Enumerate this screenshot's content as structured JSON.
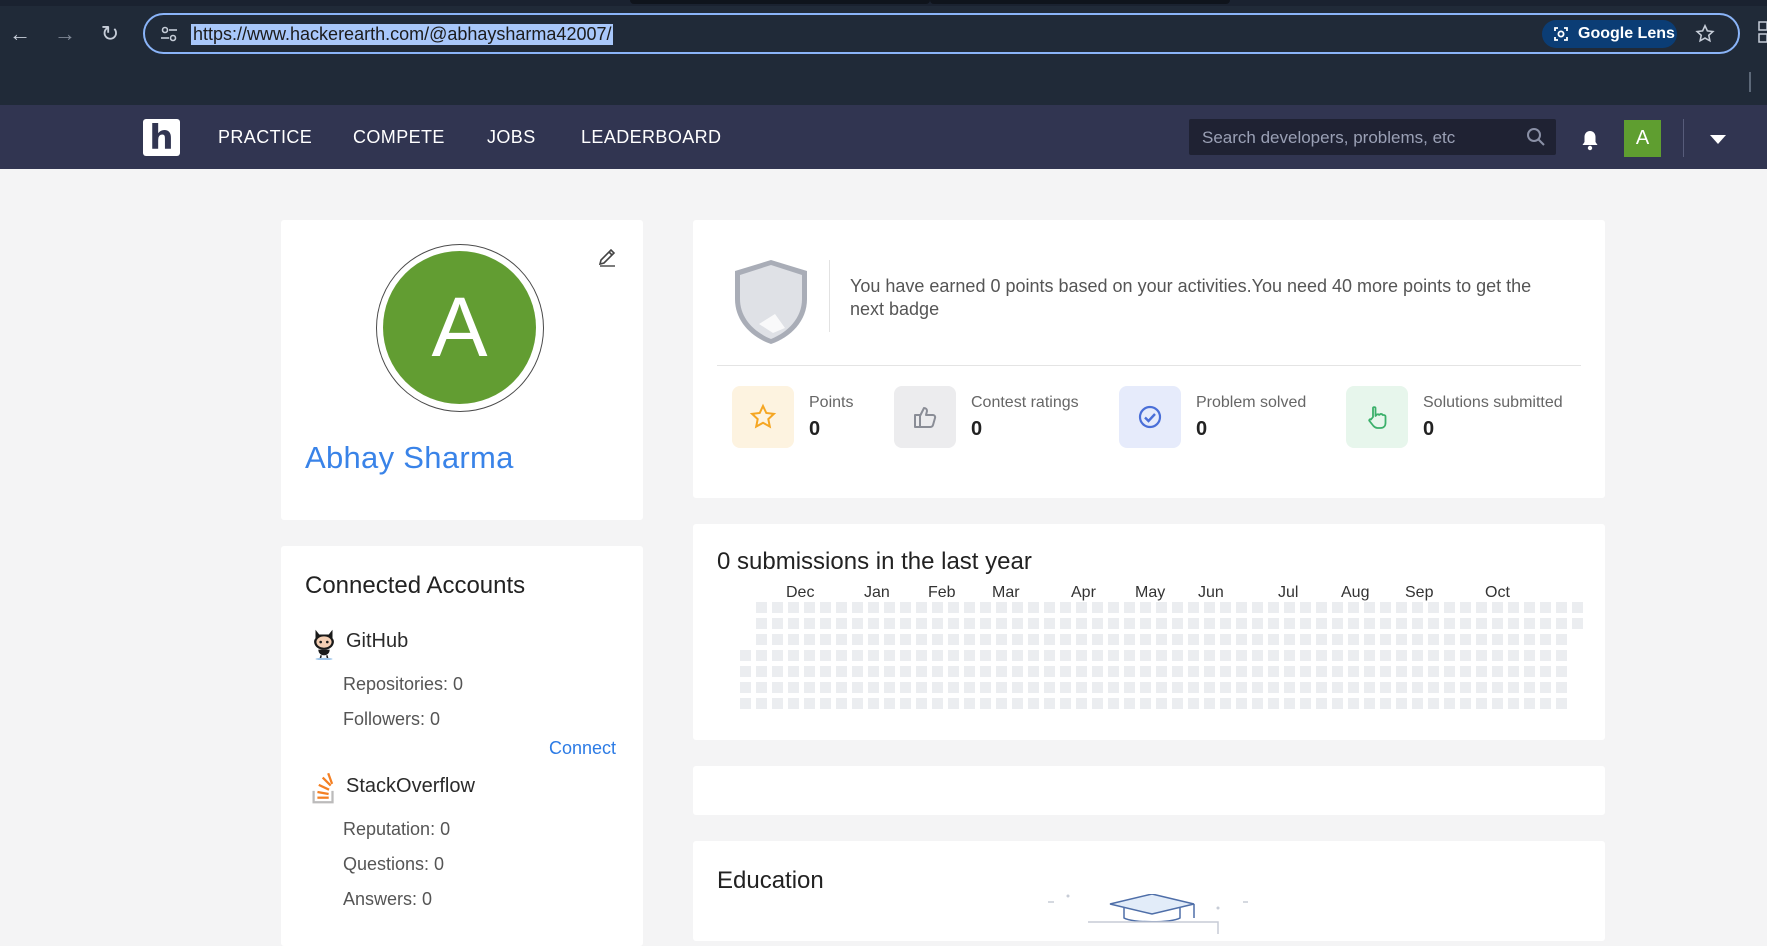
{
  "browser": {
    "url": "https://www.hackerearth.com/@abhaysharma42007/",
    "lens_label": "Google Lens"
  },
  "navbar": {
    "links": [
      "PRACTICE",
      "COMPETE",
      "JOBS",
      "LEADERBOARD"
    ],
    "search_placeholder": "Search developers, problems, etc",
    "avatar_initial": "A",
    "logo_letter": "h"
  },
  "profile": {
    "initial": "A",
    "name": "Abhay Sharma"
  },
  "accounts": {
    "title": "Connected Accounts",
    "github": {
      "name": "GitHub",
      "repositories": "Repositories: 0",
      "followers": "Followers: 0",
      "connect": "Connect"
    },
    "stackoverflow": {
      "name": "StackOverflow",
      "reputation": "Reputation: 0",
      "questions": "Questions: 0",
      "answers": "Answers: 0"
    }
  },
  "badge": {
    "text": "You have earned 0 points based on your activities.You need 40 more points to get the next badge"
  },
  "stats": [
    {
      "label": "Points",
      "value": "0",
      "icon": "star-icon",
      "color": "#fdf3e0"
    },
    {
      "label": "Contest ratings",
      "value": "0",
      "icon": "thumbs-up-icon",
      "color": "#ececee"
    },
    {
      "label": "Problem solved",
      "value": "0",
      "icon": "check-circle-icon",
      "color": "#e6ebfb"
    },
    {
      "label": "Solutions submitted",
      "value": "0",
      "icon": "pointer-hand-icon",
      "color": "#e7f6ec"
    }
  ],
  "submissions": {
    "title": "0 submissions in the last year",
    "months": [
      "Dec",
      "Jan",
      "Feb",
      "Mar",
      "Apr",
      "May",
      "Jun",
      "Jul",
      "Aug",
      "Sep",
      "Oct"
    ],
    "count": 0
  },
  "education": {
    "title": "Education"
  }
}
